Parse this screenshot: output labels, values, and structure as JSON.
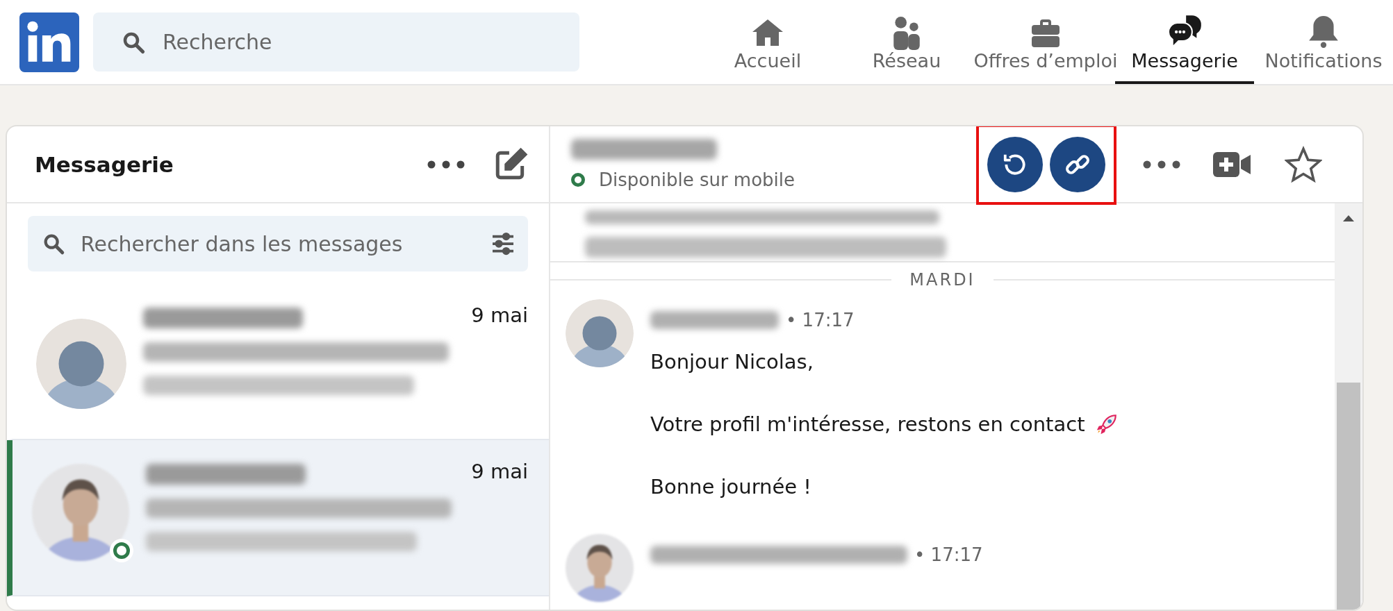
{
  "header": {
    "search": {
      "placeholder": "Recherche"
    },
    "nav": [
      {
        "label": "Accueil",
        "selected": false
      },
      {
        "label": "Réseau",
        "selected": false
      },
      {
        "label": "Offres d’emploi",
        "selected": false
      },
      {
        "label": "Messagerie",
        "selected": true
      },
      {
        "label": "Notifications",
        "selected": false
      }
    ]
  },
  "inbox": {
    "title": "Messagerie",
    "search": {
      "placeholder": "Rechercher dans les messages"
    },
    "conversations": [
      {
        "date": "9 mai",
        "selected": false,
        "kind": "silhouette",
        "online": false
      },
      {
        "date": "9 mai",
        "selected": true,
        "kind": "picture",
        "online": true
      }
    ]
  },
  "thread": {
    "status": "Disponible sur mobile",
    "online": true,
    "highlighted_actions": true,
    "day_divider": "MARDI",
    "messages": [
      {
        "time": "• 17:17",
        "kind": "silhouette",
        "lines": [
          {
            "text": "Bonjour Nicolas,",
            "kind": "plain"
          },
          {
            "text": "Votre profil m'intéresse, restons en contact",
            "kind": "emoji"
          },
          {
            "text": "Bonne journée !",
            "kind": "plain"
          }
        ]
      },
      {
        "time": "• 17:17",
        "kind": "picture"
      }
    ]
  }
}
